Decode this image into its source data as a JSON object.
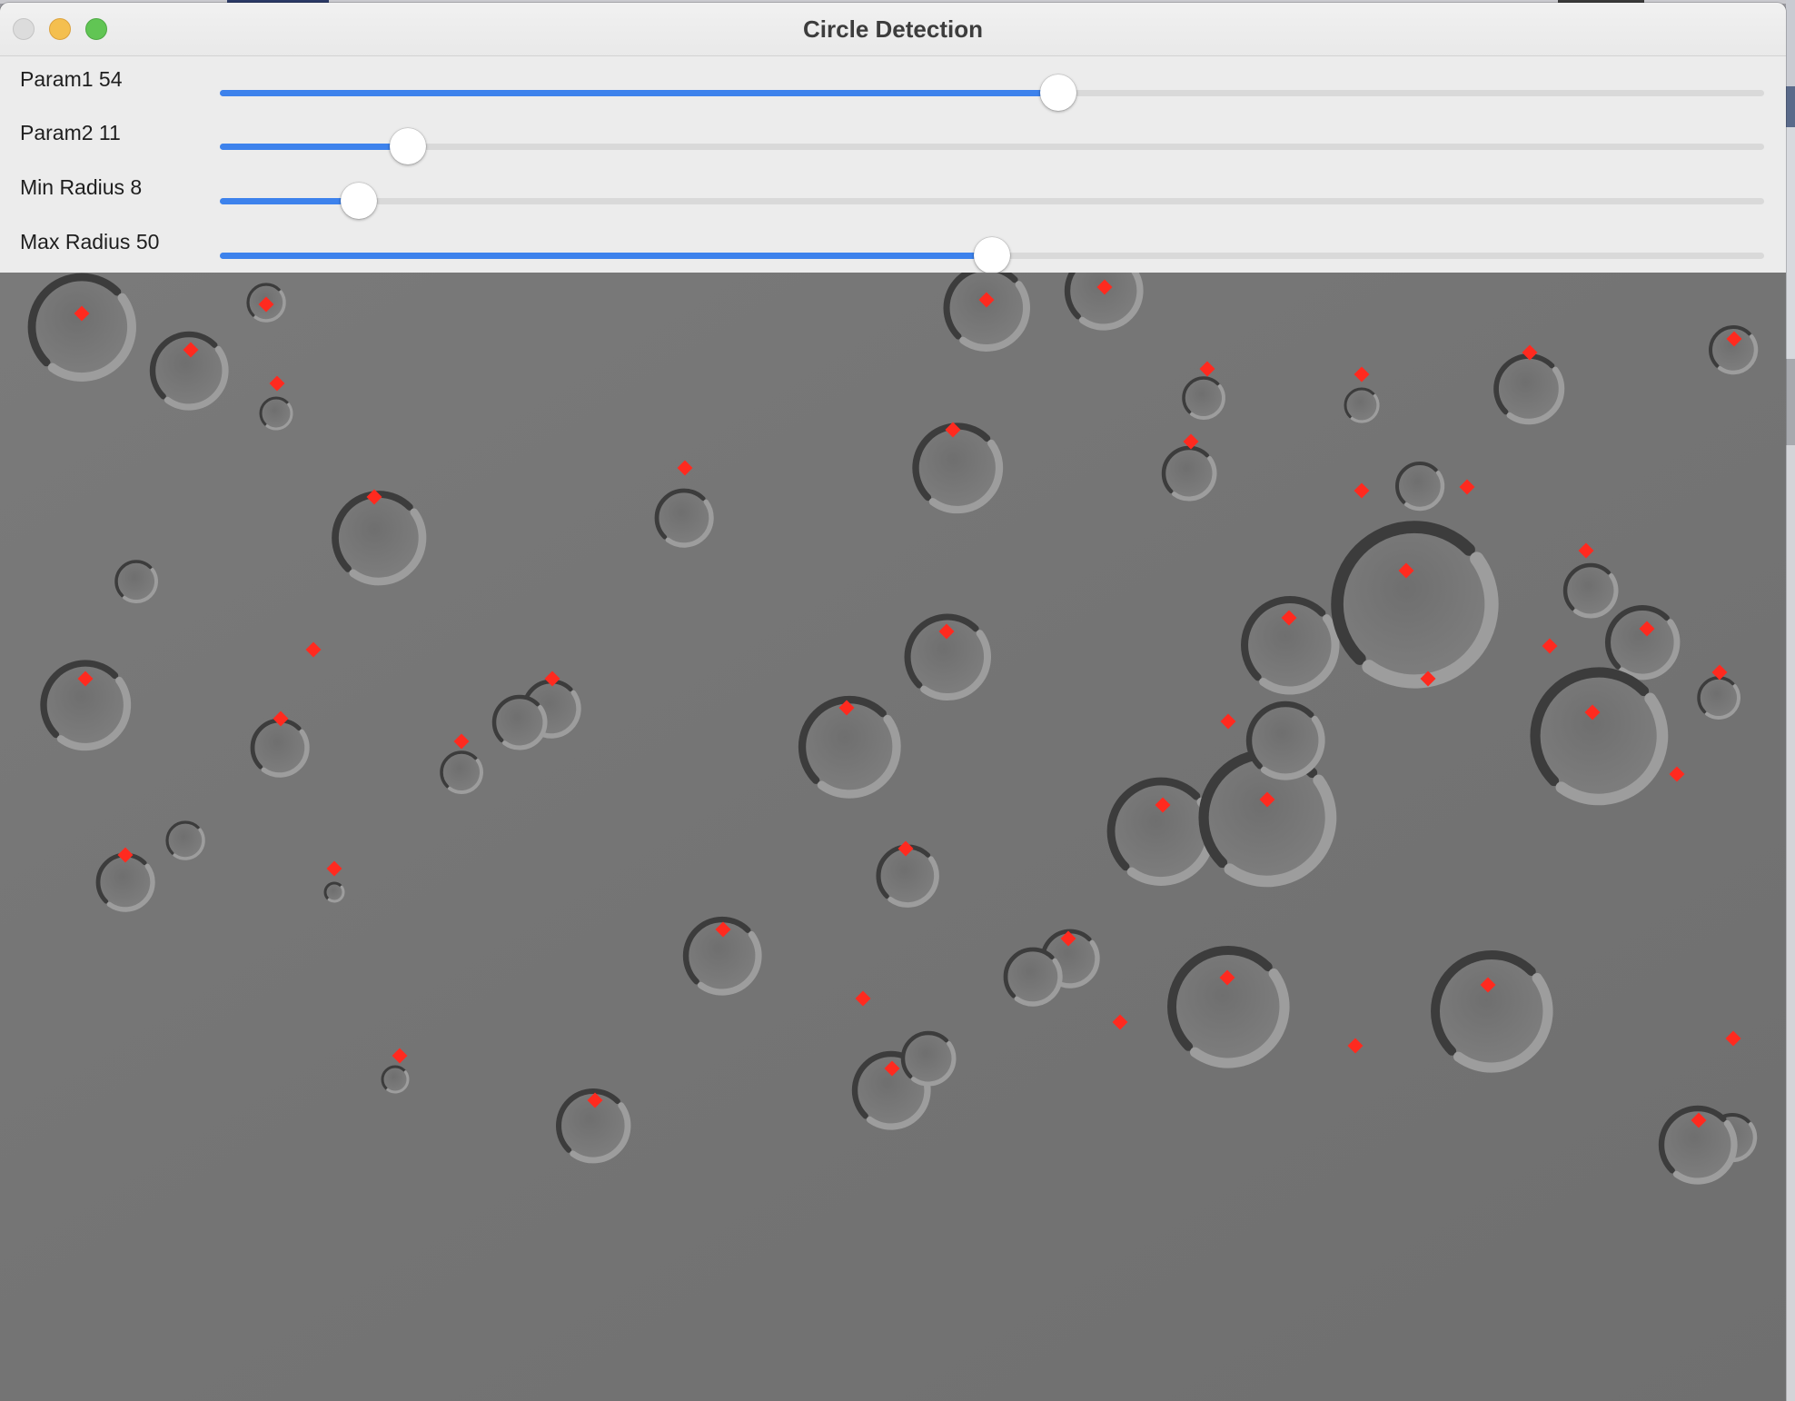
{
  "window": {
    "title": "Circle Detection"
  },
  "controls": [
    {
      "id": "param1",
      "label": "Param1 54",
      "fraction": 0.543
    },
    {
      "id": "param2",
      "label": "Param2 11",
      "fraction": 0.122
    },
    {
      "id": "min-radius",
      "label": "Min Radius 8",
      "fraction": 0.09
    },
    {
      "id": "max-radius",
      "label": "Max Radius 50",
      "fraction": 0.5
    }
  ],
  "colors": {
    "accent": "#3d82ec",
    "marker": "#ff2a1f",
    "surface": "#747474"
  },
  "icons": [
    "close-icon",
    "minimize-icon",
    "zoom-icon"
  ]
}
